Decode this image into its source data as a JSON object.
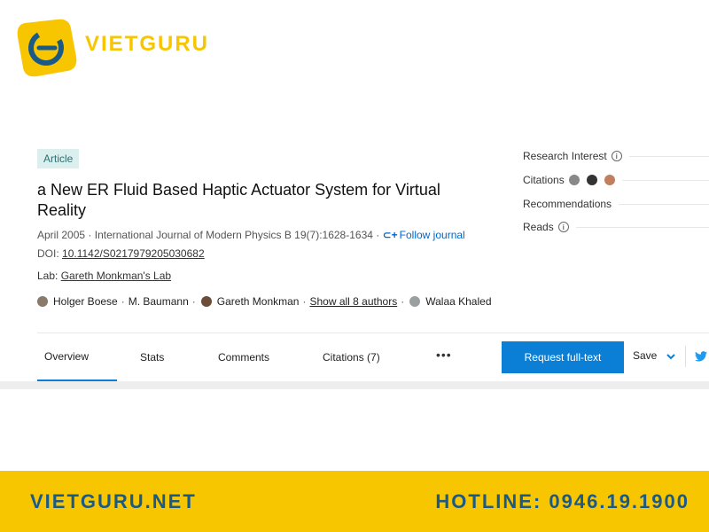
{
  "brand": {
    "name": "VIETGURU",
    "color": "#f7c600"
  },
  "article": {
    "type_badge": "Article",
    "title": "a New ER Fluid Based Haptic Actuator System for Virtual Reality",
    "date": "April 2005",
    "journal": "International Journal of Modern Physics B 19(7):1628-1634",
    "follow_label": "Follow journal",
    "doi_label": "DOI:",
    "doi": "10.1142/S0217979205030682",
    "lab_label": "Lab:",
    "lab": "Gareth Monkman's Lab",
    "authors": [
      "Holger Boese",
      "M. Baumann",
      "Gareth Monkman",
      "Show all 8 authors",
      "Walaa Khaled"
    ]
  },
  "stats": {
    "research_interest": "Research Interest",
    "citations": "Citations",
    "recommendations": "Recommendations",
    "reads": "Reads"
  },
  "tabs": [
    "Overview",
    "Stats",
    "Comments",
    "Citations (7)"
  ],
  "more_icon": "more-dots-icon",
  "actions": {
    "request": "Request full-text",
    "save": "Save"
  },
  "footer": {
    "site": "VIETGURU.NET",
    "hotline": "HOTLINE: 0946.19.1900"
  },
  "colors": {
    "accent": "#0b7fd6",
    "footer_bg": "#f7c600",
    "footer_text": "#1b5a87"
  }
}
